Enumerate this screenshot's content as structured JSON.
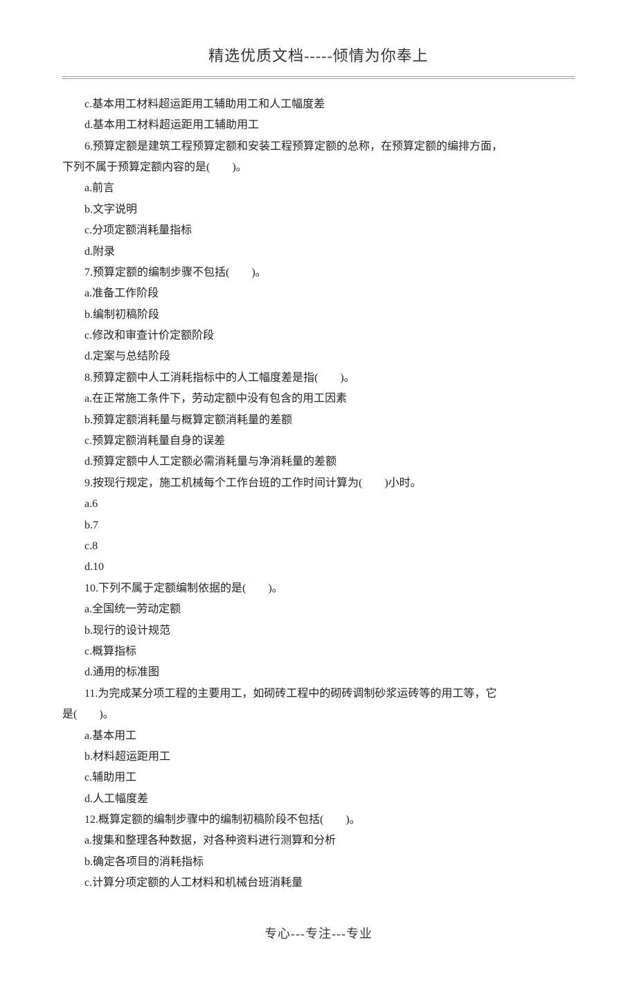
{
  "header": "精选优质文档-----倾情为你奉上",
  "footer": "专心---专注---专业",
  "lines": [
    {
      "cls": "indent-1",
      "text": "c.基本用工材料超运距用工辅助用工和人工幅度差"
    },
    {
      "cls": "indent-1",
      "text": "d.基本用工材料超运距用工辅助用工"
    },
    {
      "cls": "indent-1",
      "text": "6.预算定额是建筑工程预算定额和安装工程预算定额的总称，在预算定额的编排方面，"
    },
    {
      "cls": "no-indent",
      "text": "下列不属于预算定额内容的是(　　)。"
    },
    {
      "cls": "indent-1",
      "text": "a.前言"
    },
    {
      "cls": "indent-1",
      "text": "b.文字说明"
    },
    {
      "cls": "indent-1",
      "text": "c.分项定额消耗量指标"
    },
    {
      "cls": "indent-1",
      "text": "d.附录"
    },
    {
      "cls": "indent-1",
      "text": "7.预算定额的编制步骤不包括(　　)。"
    },
    {
      "cls": "indent-1",
      "text": "a.准备工作阶段"
    },
    {
      "cls": "indent-1",
      "text": "b.编制初稿阶段"
    },
    {
      "cls": "indent-1",
      "text": "c.修改和审查计价定额阶段"
    },
    {
      "cls": "indent-1",
      "text": "d.定案与总结阶段"
    },
    {
      "cls": "indent-1",
      "text": "8.预算定额中人工消耗指标中的人工幅度差是指(　　)。"
    },
    {
      "cls": "indent-1",
      "text": "a.在正常施工条件下，劳动定额中没有包含的用工因素"
    },
    {
      "cls": "indent-1",
      "text": "b.预算定额消耗量与概算定额消耗量的差额"
    },
    {
      "cls": "indent-1",
      "text": "c.预算定额消耗量自身的误差"
    },
    {
      "cls": "indent-1",
      "text": "d.预算定额中人工定额必需消耗量与净消耗量的差额"
    },
    {
      "cls": "indent-1",
      "text": "9.按现行规定，施工机械每个工作台班的工作时间计算为(　　)小时。"
    },
    {
      "cls": "indent-1",
      "text": "a.6"
    },
    {
      "cls": "indent-1",
      "text": "b.7"
    },
    {
      "cls": "indent-1",
      "text": "c.8"
    },
    {
      "cls": "indent-1",
      "text": "d.10"
    },
    {
      "cls": "indent-1",
      "text": "10.下列不属于定额编制依据的是(　　)。"
    },
    {
      "cls": "indent-1",
      "text": "a.全国统一劳动定额"
    },
    {
      "cls": "indent-1",
      "text": "b.现行的设计规范"
    },
    {
      "cls": "indent-1",
      "text": "c.概算指标"
    },
    {
      "cls": "indent-1",
      "text": "d.通用的标准图"
    },
    {
      "cls": "indent-1",
      "text": "11.为完成某分项工程的主要用工，如砌砖工程中的砌砖调制砂浆运砖等的用工等，它"
    },
    {
      "cls": "no-indent",
      "text": "是(　　)。"
    },
    {
      "cls": "indent-1",
      "text": "a.基本用工"
    },
    {
      "cls": "indent-1",
      "text": "b.材料超运距用工"
    },
    {
      "cls": "indent-1",
      "text": "c.辅助用工"
    },
    {
      "cls": "indent-1",
      "text": "d.人工幅度差"
    },
    {
      "cls": "indent-1",
      "text": "12.概算定额的编制步骤中的编制初稿阶段不包括(　　)。"
    },
    {
      "cls": "indent-1",
      "text": "a.搜集和整理各种数据，对各种资料进行测算和分析"
    },
    {
      "cls": "indent-1",
      "text": "b.确定各项目的消耗指标"
    },
    {
      "cls": "indent-1",
      "text": "c.计算分项定额的人工材料和机械台班消耗量"
    }
  ]
}
